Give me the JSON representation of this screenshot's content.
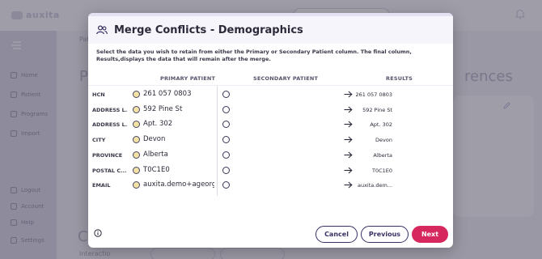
{
  "background": {
    "logo": "auxita",
    "breadcrumb": "Patients",
    "nav": [
      {
        "label": "Home"
      },
      {
        "label": "Patient"
      },
      {
        "label": "Programs"
      },
      {
        "label": "Import"
      },
      {
        "label": "Logout"
      },
      {
        "label": "Account"
      },
      {
        "label": "Help"
      },
      {
        "label": "Settings"
      }
    ],
    "left_title": "P",
    "right_title": "rences",
    "bottom_title": "C",
    "bottom_text": "Interactio"
  },
  "modal": {
    "title": "Merge Conflicts - Demographics",
    "instructions": "Select the data you wish to retain from either the Primary or Secondary Patient column. The final column, Results,displays the data that will remain after the merge.",
    "columns": {
      "primary": "PRIMARY PATIENT",
      "secondary": "SECONDARY PATIENT",
      "results": "RESULTS"
    },
    "rows": [
      {
        "label": "HCN",
        "primary": "261 057 0803",
        "secondary": "",
        "result": "261 057 0803",
        "selected": "primary"
      },
      {
        "label": "ADDRESS L...",
        "primary": "592 Pine St",
        "secondary": "",
        "result": "592 Pine St",
        "selected": "primary"
      },
      {
        "label": "ADDRESS L...",
        "primary": "Apt. 302",
        "secondary": "",
        "result": "Apt. 302",
        "selected": "primary"
      },
      {
        "label": "CITY",
        "primary": "Devon",
        "secondary": "",
        "result": "Devon",
        "selected": "primary"
      },
      {
        "label": "PROVINCE",
        "primary": "Alberta",
        "secondary": "",
        "result": "Alberta",
        "selected": "primary"
      },
      {
        "label": "POSTAL C...",
        "primary": "T0C1E0",
        "secondary": "",
        "result": "T0C1E0",
        "selected": "primary"
      },
      {
        "label": "EMAIL",
        "primary": "auxita.demo+ageorge...",
        "secondary": "",
        "result": "auxita.dem...",
        "selected": "primary"
      }
    ],
    "buttons": {
      "cancel": "Cancel",
      "previous": "Previous",
      "next": "Next"
    }
  },
  "colors": {
    "accent": "#d6285e",
    "primary_dark": "#3a2f63",
    "selected_radio": "#f2e3a5"
  },
  "icons": {
    "header": "users-icon",
    "arrow": "arrow-right-icon",
    "info": "info-icon"
  }
}
